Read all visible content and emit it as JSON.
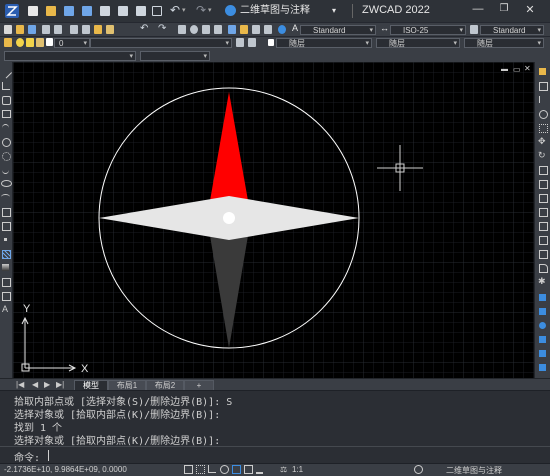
{
  "titlebar": {
    "workspace": "二维草图与注释",
    "app_title": "ZWCAD 2022"
  },
  "ribbon": {
    "text_style": "Standard",
    "dim_style": "ISO-25",
    "table_style": "Standard",
    "layer_value": "0",
    "linetype": "随层",
    "linecolor": "随层",
    "lineweight_label": "随层"
  },
  "canvas": {
    "x_axis_label": "X",
    "y_axis_label": "Y",
    "colors": {
      "north": "#ff0000",
      "south": "#3a3a3a",
      "east_west": "#e6e6e6",
      "circle": "#ffffff"
    }
  },
  "tabs": [
    {
      "label": "模型",
      "active": true
    },
    {
      "label": "布局1",
      "active": false
    },
    {
      "label": "布局2",
      "active": false
    },
    {
      "label": "+",
      "active": false
    }
  ],
  "command": {
    "lines": [
      "拾取内部点或 [选择对象(S)/删除边界(B)]: S",
      "选择对象或 [拾取内部点(K)/删除边界(B)]:",
      "找到 1 个",
      "选择对象或 [拾取内部点(K)/删除边界(B)]:"
    ],
    "prompt": "命令:"
  },
  "status": {
    "coords": "-2.1736E+10, 9.9864E+09, 0.0000",
    "scale": "1:1",
    "workspace": "二维草图与注释"
  }
}
